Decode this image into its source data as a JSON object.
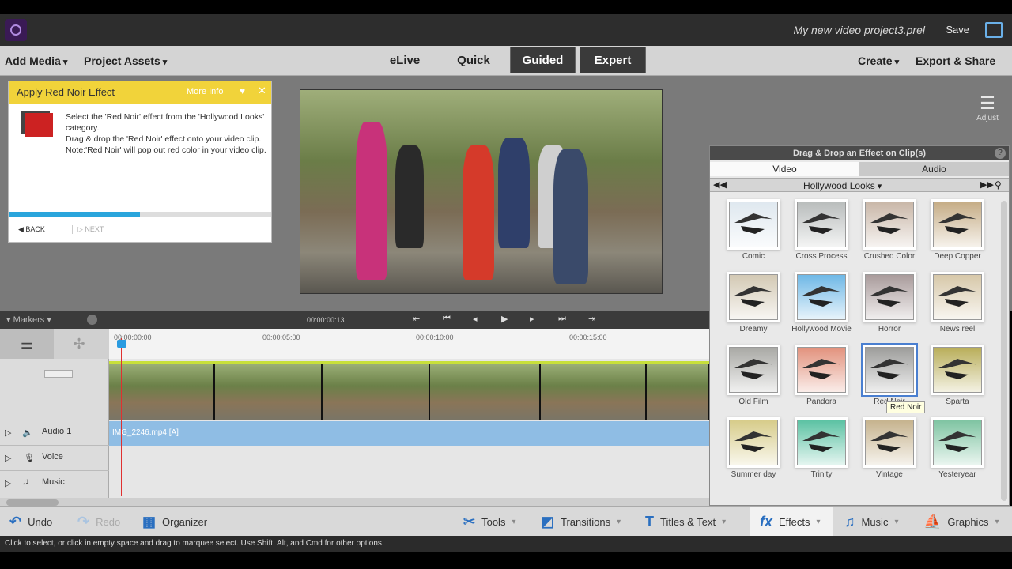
{
  "titlebar": {
    "project_title": "My new video project3.prel",
    "save_label": "Save"
  },
  "menubar": {
    "add_media": "Add Media",
    "project_assets": "Project Assets",
    "modes": [
      "eLive",
      "Quick",
      "Guided",
      "Expert"
    ],
    "active_mode": "Guided",
    "create": "Create",
    "export_share": "Export & Share"
  },
  "guide": {
    "title": "Apply Red Noir Effect",
    "more_info": "More Info",
    "line1": "Select the 'Red Noir' effect from the 'Hollywood Looks' category.",
    "line2": "Drag & drop the 'Red Noir' effect onto your video clip.",
    "line3": "Note:'Red Noir' will pop out red color in your video clip.",
    "progress": 0.5,
    "back_label": "BACK",
    "next_label": "NEXT"
  },
  "adjust": {
    "label": "Adjust"
  },
  "effects_panel": {
    "header": "Drag & Drop an Effect on Clip(s)",
    "tabs": [
      "Video",
      "Audio"
    ],
    "active_tab": "Video",
    "category": "Hollywood Looks",
    "items": [
      {
        "label": "Comic",
        "tint": "#dfe8ef"
      },
      {
        "label": "Cross Process",
        "tint": "#b9bdbc"
      },
      {
        "label": "Crushed Color",
        "tint": "#c9b7a8"
      },
      {
        "label": "Deep Copper",
        "tint": "#c6ad86"
      },
      {
        "label": "Dreamy",
        "tint": "#d3c9b4"
      },
      {
        "label": "Hollywood Movie",
        "tint": "#6fb8e6"
      },
      {
        "label": "Horror",
        "tint": "#a99b9b"
      },
      {
        "label": "News reel",
        "tint": "#d7c8a9"
      },
      {
        "label": "Old Film",
        "tint": "#a9a9a5"
      },
      {
        "label": "Pandora",
        "tint": "#e2927d"
      },
      {
        "label": "Red Noir",
        "tint": "#9d9d9b"
      },
      {
        "label": "Sparta",
        "tint": "#b9ae5a"
      },
      {
        "label": "Summer day",
        "tint": "#d7cc8a"
      },
      {
        "label": "Trinity",
        "tint": "#5cc2a3"
      },
      {
        "label": "Vintage",
        "tint": "#c6b38e"
      },
      {
        "label": "Yesteryear",
        "tint": "#7fc4a2"
      }
    ],
    "selected": "Red Noir",
    "tooltip": "Red Noir"
  },
  "timeline": {
    "markers_label": "Markers",
    "timecode": "00:00:00:13",
    "ruler_ticks": [
      "00:00:00:00",
      "00:00:05:00",
      "00:00:10:00",
      "00:00:15:00"
    ],
    "tracks": [
      "Audio 1",
      "Voice",
      "Music"
    ],
    "audio_clip_label": "IMG_2246.mp4 [A]"
  },
  "bottombar": {
    "undo": "Undo",
    "redo": "Redo",
    "organizer": "Organizer",
    "tools": "Tools",
    "transitions": "Transitions",
    "titles_text": "Titles & Text",
    "effects": "Effects",
    "music": "Music",
    "graphics": "Graphics"
  },
  "statusbar": {
    "text": "Click to select, or click in empty space and drag to marquee select. Use Shift, Alt, and Cmd for other options."
  }
}
